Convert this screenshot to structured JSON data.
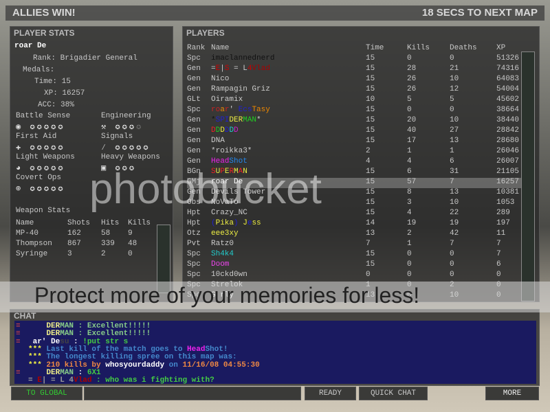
{
  "top": {
    "result": "ALLIES WIN!",
    "countdown": "18 SECS TO NEXT MAP"
  },
  "stats": {
    "title": "PLAYER STATS",
    "player": "roar De",
    "rank": "Rank: Brigadier General",
    "medals": "Medals:",
    "time": "Time: 15",
    "xp": "XP: 16257",
    "acc": "ACC: 38%",
    "skills": [
      {
        "label": "Battle Sense",
        "icon": "radio-icon",
        "stars": 5,
        "dim": 0
      },
      {
        "label": "Engineering",
        "icon": "wrench-icon",
        "stars": 3,
        "dim": 1
      },
      {
        "label": "First Aid",
        "icon": "cross-icon",
        "stars": 5,
        "dim": 0
      },
      {
        "label": "Signals",
        "icon": "signal-icon",
        "stars": 5,
        "dim": 0
      },
      {
        "label": "Light Weapons",
        "icon": "pistol-icon",
        "stars": 5,
        "dim": 0
      },
      {
        "label": "Heavy Weapons",
        "icon": "heavy-weapon-icon",
        "stars": 3,
        "dim": 0
      },
      {
        "label": "Covert Ops",
        "icon": "crosshair-icon",
        "stars": 5,
        "dim": 0
      }
    ],
    "weapon_title": "Weapon Stats",
    "weapon_headers": [
      "Name",
      "Shots",
      "Hits",
      "Kills"
    ],
    "weapons": [
      [
        "MP-40",
        "162",
        "58",
        "9"
      ],
      [
        "Thompson",
        "867",
        "339",
        "48"
      ],
      [
        "Syringe",
        "3",
        "2",
        "0"
      ]
    ]
  },
  "players": {
    "title": "PLAYERS",
    "headers": [
      "Rank",
      "Name",
      "Time",
      "Kills",
      "Deaths",
      "XP"
    ],
    "rows": [
      {
        "rank": "Spc",
        "name": [
          [
            "imaclannednerd",
            "#111"
          ]
        ],
        "time": "15",
        "kills": "0",
        "deaths": "0",
        "xp": "51326"
      },
      {
        "rank": "Gen",
        "name": [
          [
            "=",
            "#ccc"
          ],
          [
            "E",
            "#c00"
          ],
          [
            "|",
            "#ccc"
          ],
          [
            "S",
            "#c00"
          ],
          [
            " = L",
            "#ccc"
          ],
          [
            "4",
            "#c00"
          ],
          [
            "Vlad",
            "#a00"
          ]
        ],
        "time": "15",
        "kills": "28",
        "deaths": "21",
        "xp": "74316"
      },
      {
        "rank": "Gen",
        "name": [
          [
            "Nico",
            "#ccc"
          ]
        ],
        "time": "15",
        "kills": "26",
        "deaths": "10",
        "xp": "64083"
      },
      {
        "rank": "Gen",
        "name": [
          [
            "Rampagin Griz",
            "#ccc"
          ]
        ],
        "time": "15",
        "kills": "26",
        "deaths": "12",
        "xp": "54004"
      },
      {
        "rank": "GLt",
        "name": [
          [
            "Oiramix",
            "#ccc"
          ]
        ],
        "time": "10",
        "kills": "5",
        "deaths": "5",
        "xp": "45602"
      },
      {
        "rank": "Spc",
        "name": [
          [
            "ro",
            "#c22"
          ],
          [
            "a",
            "#e80"
          ],
          [
            "r",
            "#c22"
          ],
          [
            "' ",
            "#ccc"
          ],
          [
            "Ecs",
            "#22c"
          ],
          [
            "Tasy",
            "#e80"
          ]
        ],
        "time": "15",
        "kills": "0",
        "deaths": "0",
        "xp": "38664"
      },
      {
        "rank": "Gen",
        "name": [
          [
            "*",
            "#111"
          ],
          [
            "SPI",
            "#22c"
          ],
          [
            "DER",
            "#ee4"
          ],
          [
            "MAN",
            "#2c2"
          ],
          [
            "*",
            "#ccc"
          ]
        ],
        "time": "15",
        "kills": "20",
        "deaths": "10",
        "xp": "38440"
      },
      {
        "rank": "Gen",
        "name": [
          [
            "D",
            "#e22"
          ],
          [
            "D",
            "#2c2"
          ],
          [
            "D",
            "#ee4"
          ],
          [
            "D",
            "#22c"
          ],
          [
            "D",
            "#2cc"
          ],
          [
            "D",
            "#c2c"
          ]
        ],
        "time": "15",
        "kills": "40",
        "deaths": "27",
        "xp": "28842"
      },
      {
        "rank": "Gen",
        "name": [
          [
            "DNA",
            "#ccc"
          ]
        ],
        "time": "15",
        "kills": "17",
        "deaths": "13",
        "xp": "28680"
      },
      {
        "rank": "Gen",
        "name": [
          [
            "*roikka3*",
            "#ccc"
          ]
        ],
        "time": "2",
        "kills": "1",
        "deaths": "1",
        "xp": "26046"
      },
      {
        "rank": "Gen",
        "name": [
          [
            "Head",
            "#e2e"
          ],
          [
            "Shot",
            "#28e"
          ]
        ],
        "time": "4",
        "kills": "4",
        "deaths": "6",
        "xp": "26007"
      },
      {
        "rank": "BGn",
        "name": [
          [
            "S",
            "#e22"
          ],
          [
            "U",
            "#ee4"
          ],
          [
            "P",
            "#e22"
          ],
          [
            "E",
            "#ee4"
          ],
          [
            "R",
            "#e22"
          ],
          [
            "M",
            "#ee4"
          ],
          [
            "A",
            "#e22"
          ],
          [
            "N",
            "#ee4"
          ]
        ],
        "time": "15",
        "kills": "6",
        "deaths": "31",
        "xp": "21105"
      },
      {
        "rank": "GMj",
        "name": [
          [
            "roar De",
            "#fff"
          ]
        ],
        "time": "15",
        "kills": "57",
        "deaths": "7",
        "xp": "16257",
        "highlight": true
      },
      {
        "rank": "Gen",
        "name": [
          [
            "Devils Tower",
            "#ccc"
          ]
        ],
        "time": "15",
        "kills": "8",
        "deaths": "13",
        "xp": "10381"
      },
      {
        "rank": "Obs",
        "name": [
          [
            "NoVaTo",
            "#ccc"
          ]
        ],
        "time": "15",
        "kills": "3",
        "deaths": "10",
        "xp": "1053"
      },
      {
        "rank": "Hpt",
        "name": [
          [
            "Crazy_NC",
            "#ccc"
          ]
        ],
        "time": "15",
        "kills": "4",
        "deaths": "22",
        "xp": "289"
      },
      {
        "rank": "Hpt",
        "name": [
          [
            "(",
            "#22c"
          ],
          [
            "Pika",
            "#ee4"
          ],
          [
            ")",
            "#22c"
          ],
          [
            " J",
            "#ee4"
          ],
          [
            "e",
            "#22c"
          ],
          [
            "ss",
            "#ee4"
          ]
        ],
        "time": "14",
        "kills": "19",
        "deaths": "19",
        "xp": "197"
      },
      {
        "rank": "Otz",
        "name": [
          [
            "eee3xy",
            "#ee4"
          ]
        ],
        "time": "13",
        "kills": "2",
        "deaths": "42",
        "xp": "11"
      },
      {
        "rank": "Pvt",
        "name": [
          [
            "Ratz0",
            "#ccc"
          ]
        ],
        "time": "7",
        "kills": "1",
        "deaths": "7",
        "xp": "7"
      },
      {
        "rank": "Spc",
        "name": [
          [
            "Sh4k4",
            "#2cc"
          ]
        ],
        "time": "15",
        "kills": "0",
        "deaths": "0",
        "xp": "7"
      },
      {
        "rank": "Spc",
        "name": [
          [
            "Doom",
            "#e4e"
          ]
        ],
        "time": "15",
        "kills": "0",
        "deaths": "0",
        "xp": "6"
      },
      {
        "rank": "Spc",
        "name": [
          [
            "10ckd0wn",
            "#ccc"
          ]
        ],
        "time": "0",
        "kills": "0",
        "deaths": "0",
        "xp": "0"
      },
      {
        "rank": "Spc",
        "name": [
          [
            "Strelok",
            "#ccc"
          ]
        ],
        "time": "1",
        "kills": "0",
        "deaths": "2",
        "xp": "0"
      },
      {
        "rank": "Spc",
        "name": [
          [
            "G rly",
            "#fff"
          ]
        ],
        "time": "13",
        "kills": "0",
        "deaths": "10",
        "xp": "0"
      }
    ]
  },
  "chat": {
    "title": "CHAT",
    "lines": [
      [
        [
          "    DER",
          "#ee8"
        ],
        [
          "MAN",
          "#8c8"
        ],
        [
          " : ",
          "#8c8"
        ],
        [
          "Excellent!!!!!",
          "#8c8"
        ]
      ],
      [
        [
          "    DER",
          "#ee8"
        ],
        [
          "MAN",
          "#8c8"
        ],
        [
          " : ",
          "#8c8"
        ],
        [
          "Excellent!!!!!",
          "#8c8"
        ]
      ],
      [
        [
          " ar' De",
          "#fff"
        ],
        [
          "su",
          "#444"
        ],
        [
          " : ",
          "#fff"
        ],
        [
          "!put str s",
          "#4c4"
        ]
      ],
      [
        [
          "*** ",
          "#ee4"
        ],
        [
          "Last kill of the match goes to ",
          "#48c"
        ],
        [
          "Head",
          "#e2e"
        ],
        [
          "Shot",
          "#48c"
        ],
        [
          "!",
          "#48c"
        ]
      ],
      [
        [
          "*** ",
          "#ee4"
        ],
        [
          "The longest killing spree on this map was:",
          "#48c"
        ]
      ],
      [
        [
          "*** ",
          "#ee4"
        ],
        [
          "210 kills by ",
          "#e84"
        ],
        [
          "whosyourdaddy",
          "#fff"
        ],
        [
          " on ",
          "#48c"
        ],
        [
          "11/16/08 04:55:30",
          "#e84"
        ]
      ],
      [
        [
          "    DER",
          "#ee8"
        ],
        [
          "MAN",
          "#8c8"
        ],
        [
          " : ",
          "#fff"
        ],
        [
          "6X1",
          "#4c4"
        ]
      ],
      [
        [
          "= ",
          "#999"
        ],
        [
          "E",
          "#a00"
        ],
        [
          "| = L 4",
          "#999"
        ],
        [
          "Vlad",
          "#a00"
        ],
        [
          " : ",
          "#4c4"
        ],
        [
          "who was i fighting with?",
          "#4c4"
        ]
      ]
    ]
  },
  "buttons": {
    "to_global": "TO GLOBAL",
    "ready": "READY",
    "quick_chat": "QUICK CHAT",
    "more": "MORE"
  },
  "watermark": {
    "brand": "photobucket",
    "slogan": "Protect more of your memories for less!"
  }
}
